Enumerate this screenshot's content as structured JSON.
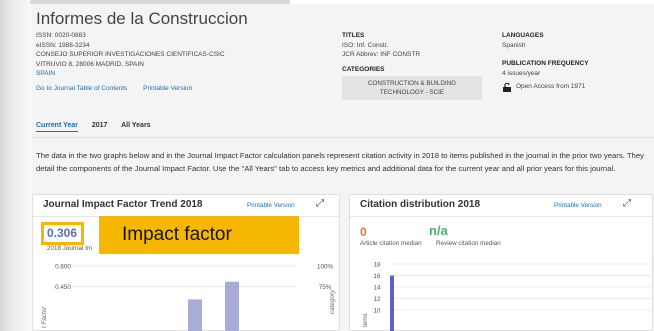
{
  "journal": {
    "title": "Informes de la Construccion",
    "issn": "ISSN: 0020-0883",
    "eissn": "eISSN: 1988-3234",
    "publisher": "CONSEJO SUPERIOR INVESTIGACIONES CIENTIFICAS-CSIC",
    "address": "VITRUVIO 8, 28006 MADRID, SPAIN",
    "country": "SPAIN",
    "toc_link": "Go to Journal Table of Contents",
    "printable_link": "Printable Version"
  },
  "titles": {
    "label": "TITLES",
    "iso": "ISO: Inf. Constr.",
    "jcr": "JCR Abbrev: INF CONSTR"
  },
  "categories": {
    "label": "CATEGORIES",
    "chip": "CONSTRUCTION & BUILDING TECHNOLOGY - SCIE"
  },
  "languages": {
    "label": "LANGUAGES",
    "value": "Spanish"
  },
  "frequency": {
    "label": "PUBLICATION FREQUENCY",
    "value": "4 issues/year",
    "open_access": "Open Access from 1971"
  },
  "tabs": [
    {
      "label": "Current Year"
    },
    {
      "label": "2017"
    },
    {
      "label": "All Years"
    }
  ],
  "description": "The data in the two graphs below and in the Journal Impact Factor calculation panels represent citation activity in 2018 to items published in the journal in the prior two years. They detail the components of the Journal Impact Factor. Use the \"All Years\" tab to access key metrics and additional data for the current year and all prior years for this journal.",
  "jif_panel": {
    "title": "Journal Impact Factor Trend 2018",
    "printable": "Printable Version",
    "value": "0.306",
    "sub_label": "2018 Journal Im",
    "callout": "Impact factor",
    "callout_color": "#f5b700",
    "y_label": "t Factor",
    "y2_label": "category"
  },
  "citation_panel": {
    "title": "Citation distribution 2018",
    "printable": "Printable Version",
    "article_median_value": "0",
    "article_median_label": "Article citation median",
    "review_median_value": "n/a",
    "review_median_label": "Review citation median",
    "y_label": "tems"
  },
  "chart_data": [
    {
      "type": "bar",
      "title": "Journal Impact Factor Trend 2018",
      "xlabel": "",
      "ylabel": "t Factor",
      "y_ticks": [
        "0.600",
        "0.450"
      ],
      "y2_ticks": [
        "100%",
        "75%"
      ],
      "ylim": [
        0.3,
        0.6
      ],
      "series": [
        {
          "values": [
            0.355,
            0.485
          ]
        }
      ],
      "bar_color": "#a9acd9"
    },
    {
      "type": "bar",
      "title": "Citation distribution 2018",
      "xlabel": "",
      "ylabel": "tems",
      "y_ticks": [
        18,
        16,
        14,
        12,
        10
      ],
      "ylim": [
        9,
        18
      ],
      "series": [
        {
          "values": [
            16
          ]
        }
      ],
      "bar_color": "#5b63c9"
    }
  ]
}
